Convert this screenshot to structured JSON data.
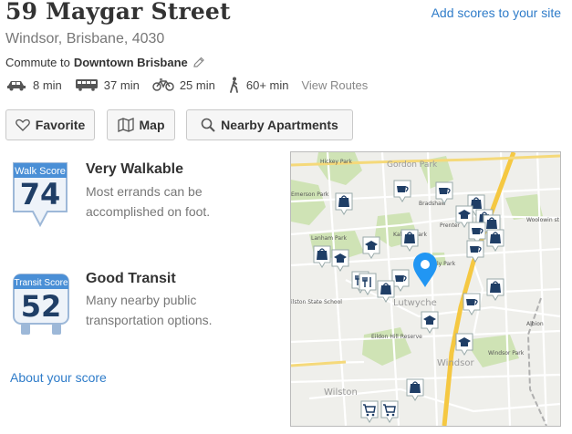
{
  "header": {
    "title": "59 Maygar Street",
    "add_scores_link": "Add scores to your site",
    "subtitle": "Windsor, Brisbane, 4030"
  },
  "commute": {
    "prefix": "Commute to",
    "destination": "Downtown Brisbane",
    "modes": [
      {
        "icon": "car-icon",
        "time": "8 min"
      },
      {
        "icon": "bus-icon",
        "time": "37 min"
      },
      {
        "icon": "bike-icon",
        "time": "25 min"
      },
      {
        "icon": "walk-icon",
        "time": "60+ min"
      }
    ],
    "view_routes": "View Routes"
  },
  "actions": {
    "favorite": "Favorite",
    "map": "Map",
    "nearby": "Nearby Apartments"
  },
  "scores": {
    "walk": {
      "label": "Walk Score",
      "value": "74",
      "heading": "Very Walkable",
      "description": "Most errands can be accomplished on foot."
    },
    "transit": {
      "label": "Transit Score",
      "value": "52",
      "heading": "Good Transit",
      "description": "Many nearby public transportation options."
    }
  },
  "about_link": "About your score",
  "map": {
    "labels": {
      "hickey": "Hickey Park",
      "gordon": "Gordon Park",
      "emerson": "Emerson Park",
      "bradshaw": "Bradshaw",
      "prenter": "Prenter",
      "woolowin": "Woolowin st",
      "lanham": "Lanham Park",
      "kalinga": "Kalinga Park",
      "ly": "ly Park",
      "ilston": "ilston State School",
      "lutwyche": "Lutwyche",
      "albion": "Albion",
      "eildon": "Eildon Hill Reserve",
      "windsor": "Windsor",
      "windsor_park": "Windsor Park",
      "wilston": "Wilston"
    },
    "colors": {
      "pin": "#2196f3",
      "marker": "#1f3e66",
      "road": "#f5c842",
      "park": "#cfe3b5"
    }
  },
  "colors": {
    "accent": "#2f7cc9",
    "score_navy": "#1f3e66",
    "badge_blue": "#4a8fd6"
  }
}
